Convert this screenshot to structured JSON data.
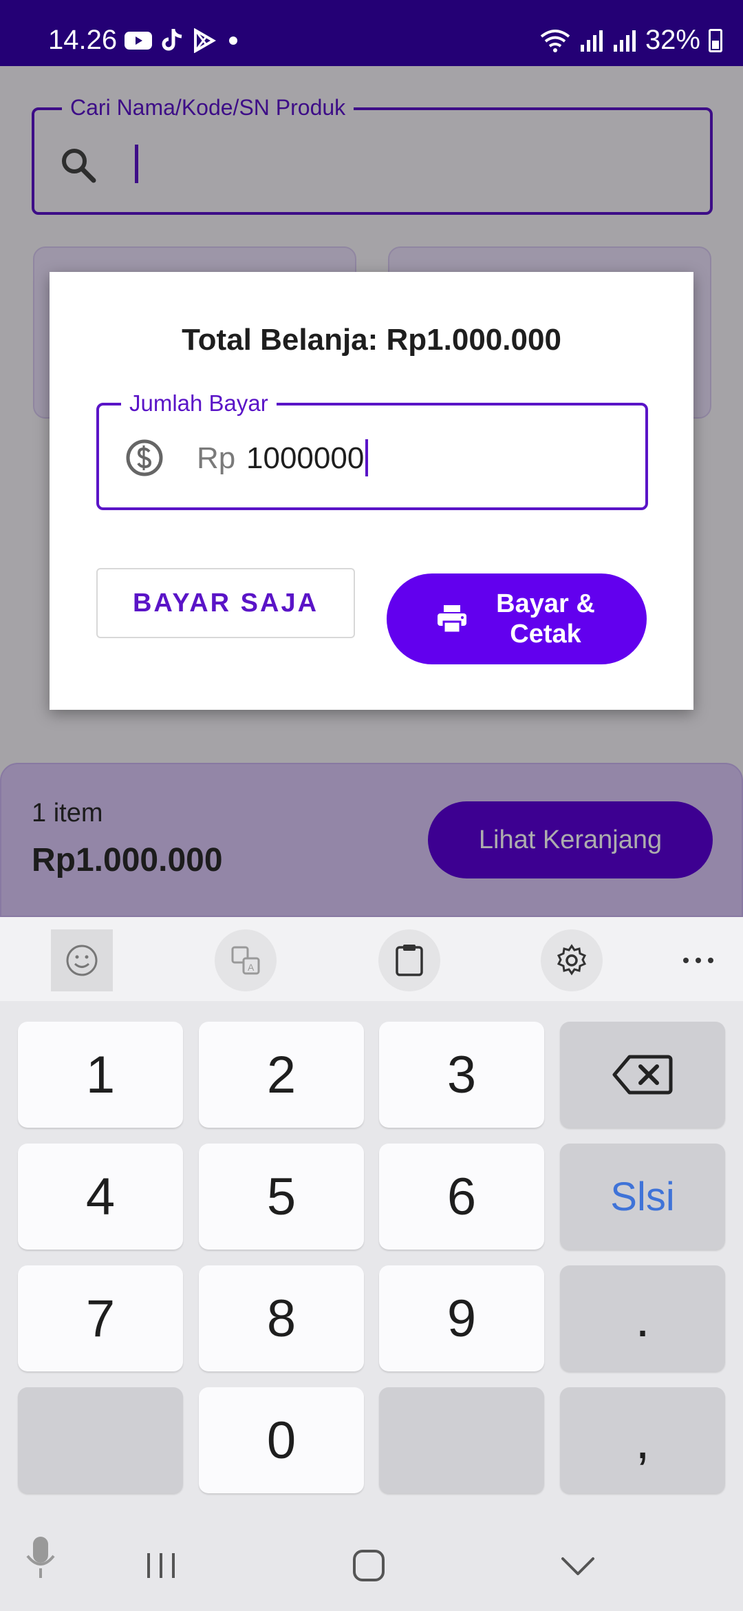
{
  "status_bar": {
    "time": "14.26",
    "battery": "32%",
    "app_icons": [
      "youtube-icon",
      "tiktok-icon",
      "play-store-icon",
      "dot-icon"
    ]
  },
  "search": {
    "label": "Cari Nama/Kode/SN Produk",
    "value": ""
  },
  "dialog": {
    "title": "Total Belanja: Rp1.000.000",
    "field_label": "Jumlah Bayar",
    "prefix": "Rp",
    "value": "1000000",
    "pay_only_label": "BAYAR SAJA",
    "pay_print_label": "Bayar & Cetak"
  },
  "cart": {
    "items_count": "1 item",
    "total": "Rp1.000.000",
    "view_cart_label": "Lihat Keranjang"
  },
  "keyboard": {
    "toolbar": [
      "emoji-icon",
      "translate-icon",
      "clipboard-icon",
      "settings-icon",
      "more-icon"
    ],
    "keys": {
      "k1": "1",
      "k2": "2",
      "k3": "3",
      "k4": "4",
      "k5": "5",
      "k6": "6",
      "k7": "7",
      "k8": "8",
      "k9": "9",
      "k0": "0",
      "enter": "Slsi",
      "dot": ".",
      "comma": ","
    }
  },
  "colors": {
    "primary": "#6200ee",
    "accent": "#5a14c7",
    "status_bar": "#240075",
    "enter_key": "#3f73d8"
  }
}
